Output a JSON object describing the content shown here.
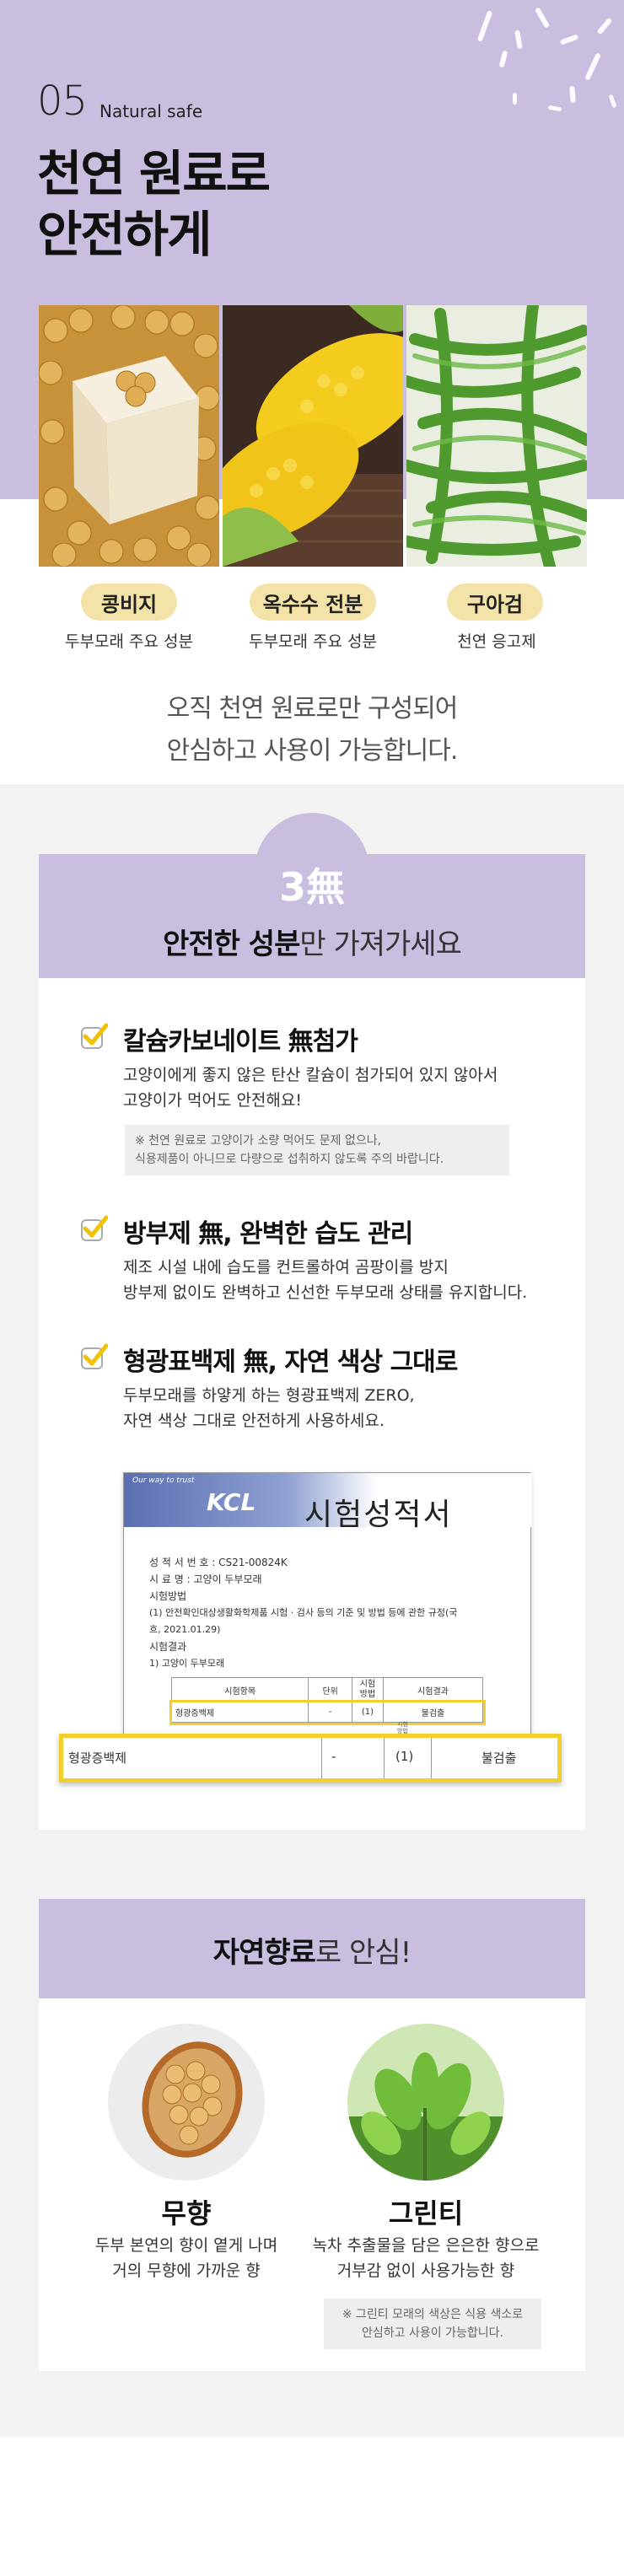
{
  "header": {
    "number": "05",
    "subtitle": "Natural safe",
    "title": "천연 원료로\n안전하게"
  },
  "ingredients": [
    {
      "tag": "콩비지",
      "caption": "두부모래 주요 성분",
      "image": "tofu-soybean-photo"
    },
    {
      "tag": "옥수수 전분",
      "caption": "두부모래 주요 성분",
      "image": "corn-photo"
    },
    {
      "tag": "구아검",
      "caption": "천연 응고제",
      "image": "green-beans-photo"
    }
  ],
  "lead_text": "오직 천연 원료로만 구성되어\n안심하고 사용이 가능합니다.",
  "three_free": {
    "badge": "3無",
    "heading_bold": "안전한 성분",
    "heading_rest": "만 가져가세요",
    "points": [
      {
        "icon": "check-icon",
        "title": "칼슘카보네이트 無첨가",
        "desc": "고양이에게 좋지 않은 탄산 칼슘이 첨가되어 있지 않아서\n고양이가 먹어도 안전해요!"
      },
      {
        "icon": "check-icon",
        "title": "방부제 無, 완벽한 습도 관리",
        "desc": "제조 시설 내에 습도를 컨트롤하여 곰팡이를 방지\n방부제 없이도 완벽하고 신선한 두부모래 상태를 유지합니다."
      },
      {
        "icon": "check-icon",
        "title": "형광표백제 無, 자연 색상 그대로",
        "desc": "두부모래를 하얗게 하는 형광표백제 ZERO,\n자연 색상 그대로 안전하게 사용하세요."
      }
    ],
    "note": "※ 천연 원료로 고양이가 소량 먹어도 문제 없으나,\n식용제품이 아니므로 다량으로 섭취하지 않도록 주의 바랍니다."
  },
  "certificate": {
    "logo": "KCL",
    "logo_tagline": "Our way to trust",
    "title": "시험성적서",
    "number_label": "성 적 서 번 호 :",
    "number_value": "CS21-00824K",
    "sample_label": "시 료 명 :",
    "sample_value": "고양이 두부모래",
    "method_label": "시험방법",
    "method_value": "(1) 안전확인대상생활화학제품 시험 · 검사 등의 기준 및 방법 등에 관한 규정(국",
    "method_value2": "흐, 2021.01.29)",
    "result_label": "시험결과",
    "result_sub": "1)    고양이 두부모래",
    "table_headers": [
      "시험항목",
      "단위",
      "시험\n방법",
      "시험결과"
    ],
    "table_row": [
      "형광증백제",
      "-",
      "(1)",
      "불검출"
    ],
    "strip_header": "시험\n방법",
    "strip_row": [
      "형광증백제",
      "-",
      "(1)",
      "불검출"
    ]
  },
  "fragrance": {
    "heading_bold": "자연향료",
    "heading_rest": "로 안심!",
    "items": [
      {
        "name": "무향",
        "desc": "두부 본연의 향이 옅게 나며\n거의 무향에 가까운 향",
        "image": "soybean-spoon-photo"
      },
      {
        "name": "그린티",
        "desc": "녹차 추출물을 담은 은은한 향으로\n거부감 없이 사용가능한 향",
        "image": "green-tea-photo"
      }
    ],
    "note": "※ 그린티 모래의 색상은 식용 색소로\n안심하고 사용이 가능합니다."
  },
  "colors": {
    "lavender": "#c9bedf",
    "tag_yellow": "#f4e3a8",
    "check_yellow": "#f2c200",
    "highlight": "#f2d02b",
    "gray_bg": "#f2f2f2"
  }
}
